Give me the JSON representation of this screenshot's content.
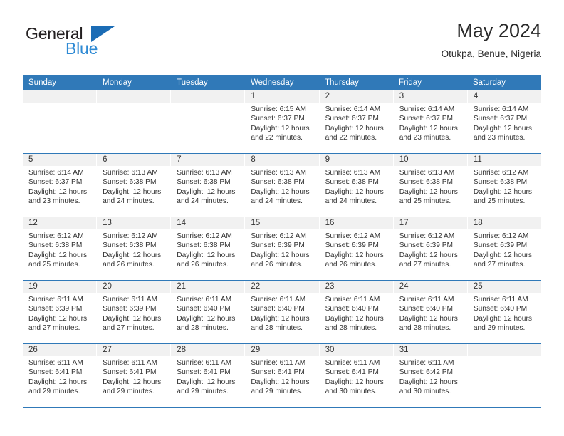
{
  "logo": {
    "word_top": "General",
    "word_bottom": "Blue",
    "triangle_color": "#1b6cb5",
    "blue_color": "#2e8ad4"
  },
  "header": {
    "title": "May 2024",
    "subtitle": "Otukpa, Benue, Nigeria"
  },
  "theme": {
    "header_blue": "#3079b8",
    "day_strip_gray": "#f1f1f1",
    "text": "#333333"
  },
  "weekdays": [
    "Sunday",
    "Monday",
    "Tuesday",
    "Wednesday",
    "Thursday",
    "Friday",
    "Saturday"
  ],
  "weeks": [
    {
      "days": [
        {
          "date": "",
          "empty": true,
          "sunrise": "",
          "sunset": "",
          "daylight": ""
        },
        {
          "date": "",
          "empty": true,
          "sunrise": "",
          "sunset": "",
          "daylight": ""
        },
        {
          "date": "",
          "empty": true,
          "sunrise": "",
          "sunset": "",
          "daylight": ""
        },
        {
          "date": "1",
          "sunrise": "Sunrise: 6:15 AM",
          "sunset": "Sunset: 6:37 PM",
          "daylight": "Daylight: 12 hours and 22 minutes."
        },
        {
          "date": "2",
          "sunrise": "Sunrise: 6:14 AM",
          "sunset": "Sunset: 6:37 PM",
          "daylight": "Daylight: 12 hours and 22 minutes."
        },
        {
          "date": "3",
          "sunrise": "Sunrise: 6:14 AM",
          "sunset": "Sunset: 6:37 PM",
          "daylight": "Daylight: 12 hours and 23 minutes."
        },
        {
          "date": "4",
          "sunrise": "Sunrise: 6:14 AM",
          "sunset": "Sunset: 6:37 PM",
          "daylight": "Daylight: 12 hours and 23 minutes."
        }
      ]
    },
    {
      "days": [
        {
          "date": "5",
          "sunrise": "Sunrise: 6:14 AM",
          "sunset": "Sunset: 6:37 PM",
          "daylight": "Daylight: 12 hours and 23 minutes."
        },
        {
          "date": "6",
          "sunrise": "Sunrise: 6:13 AM",
          "sunset": "Sunset: 6:38 PM",
          "daylight": "Daylight: 12 hours and 24 minutes."
        },
        {
          "date": "7",
          "sunrise": "Sunrise: 6:13 AM",
          "sunset": "Sunset: 6:38 PM",
          "daylight": "Daylight: 12 hours and 24 minutes."
        },
        {
          "date": "8",
          "sunrise": "Sunrise: 6:13 AM",
          "sunset": "Sunset: 6:38 PM",
          "daylight": "Daylight: 12 hours and 24 minutes."
        },
        {
          "date": "9",
          "sunrise": "Sunrise: 6:13 AM",
          "sunset": "Sunset: 6:38 PM",
          "daylight": "Daylight: 12 hours and 24 minutes."
        },
        {
          "date": "10",
          "sunrise": "Sunrise: 6:13 AM",
          "sunset": "Sunset: 6:38 PM",
          "daylight": "Daylight: 12 hours and 25 minutes."
        },
        {
          "date": "11",
          "sunrise": "Sunrise: 6:12 AM",
          "sunset": "Sunset: 6:38 PM",
          "daylight": "Daylight: 12 hours and 25 minutes."
        }
      ]
    },
    {
      "days": [
        {
          "date": "12",
          "sunrise": "Sunrise: 6:12 AM",
          "sunset": "Sunset: 6:38 PM",
          "daylight": "Daylight: 12 hours and 25 minutes."
        },
        {
          "date": "13",
          "sunrise": "Sunrise: 6:12 AM",
          "sunset": "Sunset: 6:38 PM",
          "daylight": "Daylight: 12 hours and 26 minutes."
        },
        {
          "date": "14",
          "sunrise": "Sunrise: 6:12 AM",
          "sunset": "Sunset: 6:38 PM",
          "daylight": "Daylight: 12 hours and 26 minutes."
        },
        {
          "date": "15",
          "sunrise": "Sunrise: 6:12 AM",
          "sunset": "Sunset: 6:39 PM",
          "daylight": "Daylight: 12 hours and 26 minutes."
        },
        {
          "date": "16",
          "sunrise": "Sunrise: 6:12 AM",
          "sunset": "Sunset: 6:39 PM",
          "daylight": "Daylight: 12 hours and 26 minutes."
        },
        {
          "date": "17",
          "sunrise": "Sunrise: 6:12 AM",
          "sunset": "Sunset: 6:39 PM",
          "daylight": "Daylight: 12 hours and 27 minutes."
        },
        {
          "date": "18",
          "sunrise": "Sunrise: 6:12 AM",
          "sunset": "Sunset: 6:39 PM",
          "daylight": "Daylight: 12 hours and 27 minutes."
        }
      ]
    },
    {
      "days": [
        {
          "date": "19",
          "sunrise": "Sunrise: 6:11 AM",
          "sunset": "Sunset: 6:39 PM",
          "daylight": "Daylight: 12 hours and 27 minutes."
        },
        {
          "date": "20",
          "sunrise": "Sunrise: 6:11 AM",
          "sunset": "Sunset: 6:39 PM",
          "daylight": "Daylight: 12 hours and 27 minutes."
        },
        {
          "date": "21",
          "sunrise": "Sunrise: 6:11 AM",
          "sunset": "Sunset: 6:40 PM",
          "daylight": "Daylight: 12 hours and 28 minutes."
        },
        {
          "date": "22",
          "sunrise": "Sunrise: 6:11 AM",
          "sunset": "Sunset: 6:40 PM",
          "daylight": "Daylight: 12 hours and 28 minutes."
        },
        {
          "date": "23",
          "sunrise": "Sunrise: 6:11 AM",
          "sunset": "Sunset: 6:40 PM",
          "daylight": "Daylight: 12 hours and 28 minutes."
        },
        {
          "date": "24",
          "sunrise": "Sunrise: 6:11 AM",
          "sunset": "Sunset: 6:40 PM",
          "daylight": "Daylight: 12 hours and 28 minutes."
        },
        {
          "date": "25",
          "sunrise": "Sunrise: 6:11 AM",
          "sunset": "Sunset: 6:40 PM",
          "daylight": "Daylight: 12 hours and 29 minutes."
        }
      ]
    },
    {
      "days": [
        {
          "date": "26",
          "sunrise": "Sunrise: 6:11 AM",
          "sunset": "Sunset: 6:41 PM",
          "daylight": "Daylight: 12 hours and 29 minutes."
        },
        {
          "date": "27",
          "sunrise": "Sunrise: 6:11 AM",
          "sunset": "Sunset: 6:41 PM",
          "daylight": "Daylight: 12 hours and 29 minutes."
        },
        {
          "date": "28",
          "sunrise": "Sunrise: 6:11 AM",
          "sunset": "Sunset: 6:41 PM",
          "daylight": "Daylight: 12 hours and 29 minutes."
        },
        {
          "date": "29",
          "sunrise": "Sunrise: 6:11 AM",
          "sunset": "Sunset: 6:41 PM",
          "daylight": "Daylight: 12 hours and 29 minutes."
        },
        {
          "date": "30",
          "sunrise": "Sunrise: 6:11 AM",
          "sunset": "Sunset: 6:41 PM",
          "daylight": "Daylight: 12 hours and 30 minutes."
        },
        {
          "date": "31",
          "sunrise": "Sunrise: 6:11 AM",
          "sunset": "Sunset: 6:42 PM",
          "daylight": "Daylight: 12 hours and 30 minutes."
        },
        {
          "date": "",
          "empty": true,
          "sunrise": "",
          "sunset": "",
          "daylight": ""
        }
      ]
    }
  ]
}
